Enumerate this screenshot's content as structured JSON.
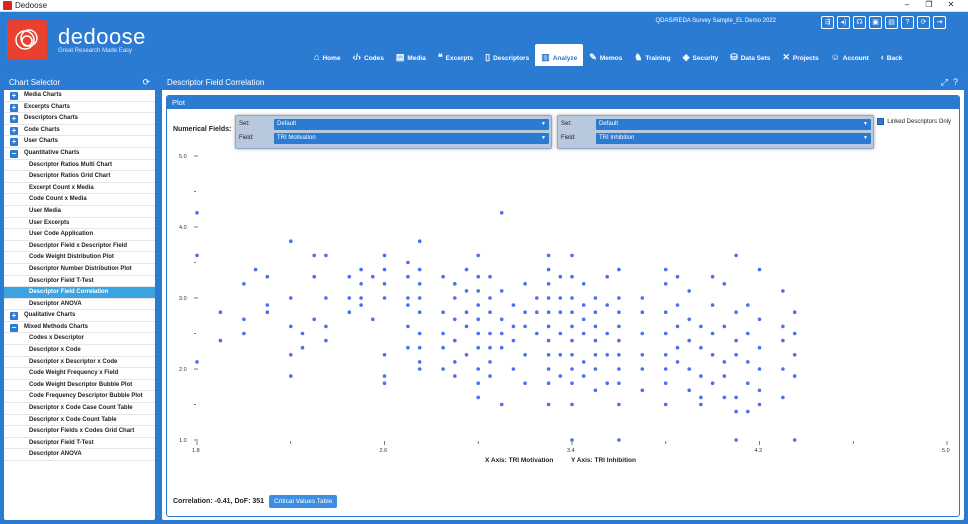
{
  "window": {
    "title": "Dedoose"
  },
  "header": {
    "brand": "dedoose",
    "tagline": "Great Research Made Easy",
    "project": "QDAS/REDA Survey Sample_EL Demo 2022"
  },
  "nav": [
    {
      "label": "Home",
      "icon": "home-icon",
      "glyph": "⌂"
    },
    {
      "label": "Codes",
      "icon": "code-icon",
      "glyph": "‹/›"
    },
    {
      "label": "Media",
      "icon": "media-icon",
      "glyph": "▤"
    },
    {
      "label": "Excerpts",
      "icon": "excerpt-icon",
      "glyph": "❝"
    },
    {
      "label": "Descriptors",
      "icon": "descriptor-icon",
      "glyph": "▯"
    },
    {
      "label": "Analyze",
      "icon": "analyze-icon",
      "glyph": "▥",
      "active": true
    },
    {
      "label": "Memos",
      "icon": "memo-icon",
      "glyph": "✎"
    },
    {
      "label": "Training",
      "icon": "training-icon",
      "glyph": "♞"
    },
    {
      "label": "Security",
      "icon": "security-icon",
      "glyph": "◈"
    },
    {
      "label": "Data Sets",
      "icon": "dataset-icon",
      "glyph": "⛁"
    },
    {
      "label": "Projects",
      "icon": "projects-icon",
      "glyph": "✕"
    },
    {
      "label": "Account",
      "icon": "account-icon",
      "glyph": "☺"
    },
    {
      "label": "Back",
      "icon": "back-icon",
      "glyph": "‹"
    }
  ],
  "chart_selector": {
    "title": "Chart Selector",
    "items": [
      {
        "label": "Media Charts",
        "level": 0,
        "state": "+"
      },
      {
        "label": "Excerpts Charts",
        "level": 0,
        "state": "+"
      },
      {
        "label": "Descriptors Charts",
        "level": 0,
        "state": "+"
      },
      {
        "label": "Code Charts",
        "level": 0,
        "state": "+"
      },
      {
        "label": "User Charts",
        "level": 0,
        "state": "+"
      },
      {
        "label": "Quantitative Charts",
        "level": 0,
        "state": "−"
      },
      {
        "label": "Descriptor Ratios Multi Chart",
        "level": 1
      },
      {
        "label": "Descriptor Ratios Grid Chart",
        "level": 1
      },
      {
        "label": "Excerpt Count x Media",
        "level": 1
      },
      {
        "label": "Code Count x Media",
        "level": 1
      },
      {
        "label": "User Media",
        "level": 1
      },
      {
        "label": "User Excerpts",
        "level": 1
      },
      {
        "label": "User Code Application",
        "level": 1
      },
      {
        "label": "Descriptor Field x Descriptor Field",
        "level": 1
      },
      {
        "label": "Code Weight Distribution Plot",
        "level": 1
      },
      {
        "label": "Descriptor Number Distribution Plot",
        "level": 1
      },
      {
        "label": "Descriptor Field T-Test",
        "level": 1
      },
      {
        "label": "Descriptor Field Correlation",
        "level": 1,
        "selected": true
      },
      {
        "label": "Descriptor ANOVA",
        "level": 1
      },
      {
        "label": "Qualitative Charts",
        "level": 0,
        "state": "+"
      },
      {
        "label": "Mixed Methods Charts",
        "level": 0,
        "state": "−"
      },
      {
        "label": "Codes x Descriptor",
        "level": 1
      },
      {
        "label": "Descriptor x Code",
        "level": 1
      },
      {
        "label": "Descriptor x Descriptor x Code",
        "level": 1
      },
      {
        "label": "Code Weight Frequency x Field",
        "level": 1
      },
      {
        "label": "Code Weight Descriptor Bubble Plot",
        "level": 1
      },
      {
        "label": "Code Frequency Descriptor Bubble Plot",
        "level": 1
      },
      {
        "label": "Descriptor x Code Case Count Table",
        "level": 1
      },
      {
        "label": "Descriptor x Code Count Table",
        "level": 1
      },
      {
        "label": "Descriptor Fields x Codes Grid Chart",
        "level": 1
      },
      {
        "label": "Descriptor Field T-Test",
        "level": 1
      },
      {
        "label": "Descriptor ANOVA",
        "level": 1
      }
    ]
  },
  "main": {
    "title": "Descriptor Field Correlation",
    "plot_title": "Plot",
    "numerical_fields_label": "Numerical Fields:",
    "x_selector": {
      "set_label": "Set:",
      "set_value": "Default",
      "field_label": "Field:",
      "field_value": "TRI Motivation"
    },
    "y_selector": {
      "set_label": "Set:",
      "set_value": "Default",
      "field_label": "Field:",
      "field_value": "TRI Inhibition"
    },
    "linked_label": "Linked Descriptors Only",
    "correlation_text": "Correlation: -0.41, DoF: 351",
    "critical_button": "Critical Values Table"
  },
  "chart_data": {
    "type": "scatter",
    "xlabel": "X Axis: TRI Motivation",
    "ylabel": "Y Axis: TRI Inhibition",
    "xlim": [
      1.8,
      5.0
    ],
    "ylim": [
      1.0,
      5.0
    ],
    "x_ticks": [
      "1.8",
      "2.6",
      "3.4",
      "4.2",
      "5.0"
    ],
    "y_ticks": [
      "1.0",
      "2.0",
      "3.0",
      "4.0",
      "5.0"
    ],
    "color": "#4a6ff0",
    "points": [
      [
        1.8,
        4.2
      ],
      [
        1.8,
        3.6
      ],
      [
        1.8,
        2.1
      ],
      [
        1.9,
        2.8
      ],
      [
        1.9,
        2.4
      ],
      [
        2.0,
        3.2
      ],
      [
        2.0,
        2.7
      ],
      [
        2.0,
        2.5
      ],
      [
        2.05,
        3.4
      ],
      [
        2.1,
        2.8
      ],
      [
        2.1,
        2.9
      ],
      [
        2.1,
        3.3
      ],
      [
        2.2,
        3.8
      ],
      [
        2.2,
        3.0
      ],
      [
        2.2,
        2.6
      ],
      [
        2.2,
        2.2
      ],
      [
        2.2,
        1.9
      ],
      [
        2.25,
        2.5
      ],
      [
        2.25,
        2.3
      ],
      [
        2.3,
        3.6
      ],
      [
        2.3,
        3.3
      ],
      [
        2.3,
        2.7
      ],
      [
        2.35,
        3.6
      ],
      [
        2.35,
        3.0
      ],
      [
        2.35,
        2.6
      ],
      [
        2.35,
        2.4
      ],
      [
        2.45,
        3.3
      ],
      [
        2.45,
        3.0
      ],
      [
        2.45,
        2.8
      ],
      [
        2.5,
        3.4
      ],
      [
        2.5,
        3.2
      ],
      [
        2.5,
        3.0
      ],
      [
        2.5,
        2.9
      ],
      [
        2.55,
        3.3
      ],
      [
        2.55,
        2.7
      ],
      [
        2.6,
        3.6
      ],
      [
        2.6,
        3.4
      ],
      [
        2.6,
        3.2
      ],
      [
        2.6,
        3.0
      ],
      [
        2.6,
        2.2
      ],
      [
        2.6,
        1.9
      ],
      [
        2.6,
        1.8
      ],
      [
        2.7,
        3.5
      ],
      [
        2.7,
        3.3
      ],
      [
        2.7,
        3.0
      ],
      [
        2.7,
        2.9
      ],
      [
        2.7,
        2.6
      ],
      [
        2.7,
        2.3
      ],
      [
        2.75,
        3.8
      ],
      [
        2.75,
        3.4
      ],
      [
        2.75,
        3.2
      ],
      [
        2.75,
        3.0
      ],
      [
        2.75,
        2.8
      ],
      [
        2.75,
        2.5
      ],
      [
        2.75,
        2.3
      ],
      [
        2.75,
        2.1
      ],
      [
        2.75,
        2.0
      ],
      [
        2.85,
        3.3
      ],
      [
        2.85,
        2.8
      ],
      [
        2.85,
        2.5
      ],
      [
        2.85,
        2.3
      ],
      [
        2.85,
        2.0
      ],
      [
        2.9,
        3.2
      ],
      [
        2.9,
        3.0
      ],
      [
        2.9,
        2.7
      ],
      [
        2.9,
        2.4
      ],
      [
        2.9,
        2.1
      ],
      [
        2.9,
        1.9
      ],
      [
        2.95,
        3.4
      ],
      [
        2.95,
        3.1
      ],
      [
        2.95,
        2.8
      ],
      [
        2.95,
        2.6
      ],
      [
        2.95,
        2.2
      ],
      [
        3.0,
        3.6
      ],
      [
        3.0,
        3.3
      ],
      [
        3.0,
        3.1
      ],
      [
        3.0,
        2.9
      ],
      [
        3.0,
        2.7
      ],
      [
        3.0,
        2.5
      ],
      [
        3.0,
        2.3
      ],
      [
        3.0,
        2.0
      ],
      [
        3.0,
        1.8
      ],
      [
        3.0,
        1.6
      ],
      [
        3.05,
        3.3
      ],
      [
        3.05,
        3.0
      ],
      [
        3.05,
        2.8
      ],
      [
        3.05,
        2.5
      ],
      [
        3.05,
        2.3
      ],
      [
        3.05,
        2.1
      ],
      [
        3.05,
        1.9
      ],
      [
        3.1,
        4.2
      ],
      [
        3.1,
        3.1
      ],
      [
        3.1,
        2.7
      ],
      [
        3.1,
        2.5
      ],
      [
        3.1,
        2.3
      ],
      [
        3.1,
        1.5
      ],
      [
        3.15,
        2.9
      ],
      [
        3.15,
        2.6
      ],
      [
        3.15,
        2.4
      ],
      [
        3.15,
        2.0
      ],
      [
        3.2,
        3.2
      ],
      [
        3.2,
        2.8
      ],
      [
        3.2,
        2.6
      ],
      [
        3.2,
        2.2
      ],
      [
        3.2,
        1.8
      ],
      [
        3.25,
        3.0
      ],
      [
        3.25,
        2.8
      ],
      [
        3.25,
        2.5
      ],
      [
        3.3,
        3.6
      ],
      [
        3.3,
        3.4
      ],
      [
        3.3,
        3.2
      ],
      [
        3.3,
        3.0
      ],
      [
        3.3,
        2.8
      ],
      [
        3.3,
        2.6
      ],
      [
        3.3,
        2.4
      ],
      [
        3.3,
        2.2
      ],
      [
        3.3,
        2.0
      ],
      [
        3.3,
        1.8
      ],
      [
        3.3,
        1.5
      ],
      [
        3.35,
        3.3
      ],
      [
        3.35,
        3.0
      ],
      [
        3.35,
        2.8
      ],
      [
        3.35,
        2.5
      ],
      [
        3.35,
        2.2
      ],
      [
        3.35,
        1.9
      ],
      [
        3.4,
        3.6
      ],
      [
        3.4,
        3.3
      ],
      [
        3.4,
        3.0
      ],
      [
        3.4,
        2.8
      ],
      [
        3.4,
        2.6
      ],
      [
        3.4,
        2.4
      ],
      [
        3.4,
        2.2
      ],
      [
        3.4,
        2.0
      ],
      [
        3.4,
        1.8
      ],
      [
        3.4,
        1.5
      ],
      [
        3.4,
        1.0
      ],
      [
        3.45,
        3.2
      ],
      [
        3.45,
        2.9
      ],
      [
        3.45,
        2.7
      ],
      [
        3.45,
        2.5
      ],
      [
        3.45,
        2.1
      ],
      [
        3.45,
        1.9
      ],
      [
        3.5,
        3.0
      ],
      [
        3.5,
        2.8
      ],
      [
        3.5,
        2.6
      ],
      [
        3.5,
        2.4
      ],
      [
        3.5,
        2.2
      ],
      [
        3.5,
        2.0
      ],
      [
        3.5,
        1.7
      ],
      [
        3.55,
        3.3
      ],
      [
        3.55,
        2.9
      ],
      [
        3.55,
        2.5
      ],
      [
        3.55,
        2.2
      ],
      [
        3.55,
        1.8
      ],
      [
        3.6,
        3.4
      ],
      [
        3.6,
        3.0
      ],
      [
        3.6,
        2.8
      ],
      [
        3.6,
        2.6
      ],
      [
        3.6,
        2.4
      ],
      [
        3.6,
        2.2
      ],
      [
        3.6,
        2.0
      ],
      [
        3.6,
        1.8
      ],
      [
        3.6,
        1.5
      ],
      [
        3.6,
        1.0
      ],
      [
        3.7,
        3.0
      ],
      [
        3.7,
        2.8
      ],
      [
        3.7,
        2.5
      ],
      [
        3.7,
        2.2
      ],
      [
        3.7,
        2.0
      ],
      [
        3.7,
        1.7
      ],
      [
        3.8,
        3.4
      ],
      [
        3.8,
        3.2
      ],
      [
        3.8,
        2.8
      ],
      [
        3.8,
        2.5
      ],
      [
        3.8,
        2.2
      ],
      [
        3.8,
        2.0
      ],
      [
        3.8,
        1.8
      ],
      [
        3.8,
        1.5
      ],
      [
        3.85,
        3.3
      ],
      [
        3.85,
        2.9
      ],
      [
        3.85,
        2.6
      ],
      [
        3.85,
        2.3
      ],
      [
        3.85,
        2.1
      ],
      [
        3.9,
        3.1
      ],
      [
        3.9,
        2.7
      ],
      [
        3.9,
        2.4
      ],
      [
        3.9,
        2.0
      ],
      [
        3.9,
        1.7
      ],
      [
        3.95,
        2.6
      ],
      [
        3.95,
        2.3
      ],
      [
        3.95,
        1.9
      ],
      [
        3.95,
        1.6
      ],
      [
        3.95,
        1.5
      ],
      [
        4.0,
        3.3
      ],
      [
        4.0,
        2.9
      ],
      [
        4.0,
        2.5
      ],
      [
        4.0,
        2.2
      ],
      [
        4.0,
        1.8
      ],
      [
        4.05,
        3.2
      ],
      [
        4.05,
        2.6
      ],
      [
        4.05,
        2.1
      ],
      [
        4.05,
        1.9
      ],
      [
        4.05,
        1.6
      ],
      [
        4.1,
        3.6
      ],
      [
        4.1,
        2.8
      ],
      [
        4.1,
        2.4
      ],
      [
        4.1,
        2.2
      ],
      [
        4.1,
        1.6
      ],
      [
        4.1,
        1.4
      ],
      [
        4.1,
        1.0
      ],
      [
        4.15,
        2.9
      ],
      [
        4.15,
        2.5
      ],
      [
        4.15,
        2.1
      ],
      [
        4.15,
        1.8
      ],
      [
        4.15,
        1.4
      ],
      [
        4.2,
        3.4
      ],
      [
        4.2,
        2.7
      ],
      [
        4.2,
        2.3
      ],
      [
        4.2,
        2.0
      ],
      [
        4.2,
        1.7
      ],
      [
        4.2,
        1.5
      ],
      [
        4.3,
        3.1
      ],
      [
        4.3,
        2.6
      ],
      [
        4.3,
        2.4
      ],
      [
        4.3,
        2.0
      ],
      [
        4.3,
        1.6
      ],
      [
        4.35,
        2.8
      ],
      [
        4.35,
        2.5
      ],
      [
        4.35,
        2.2
      ],
      [
        4.35,
        1.9
      ],
      [
        4.35,
        1.0
      ]
    ]
  }
}
